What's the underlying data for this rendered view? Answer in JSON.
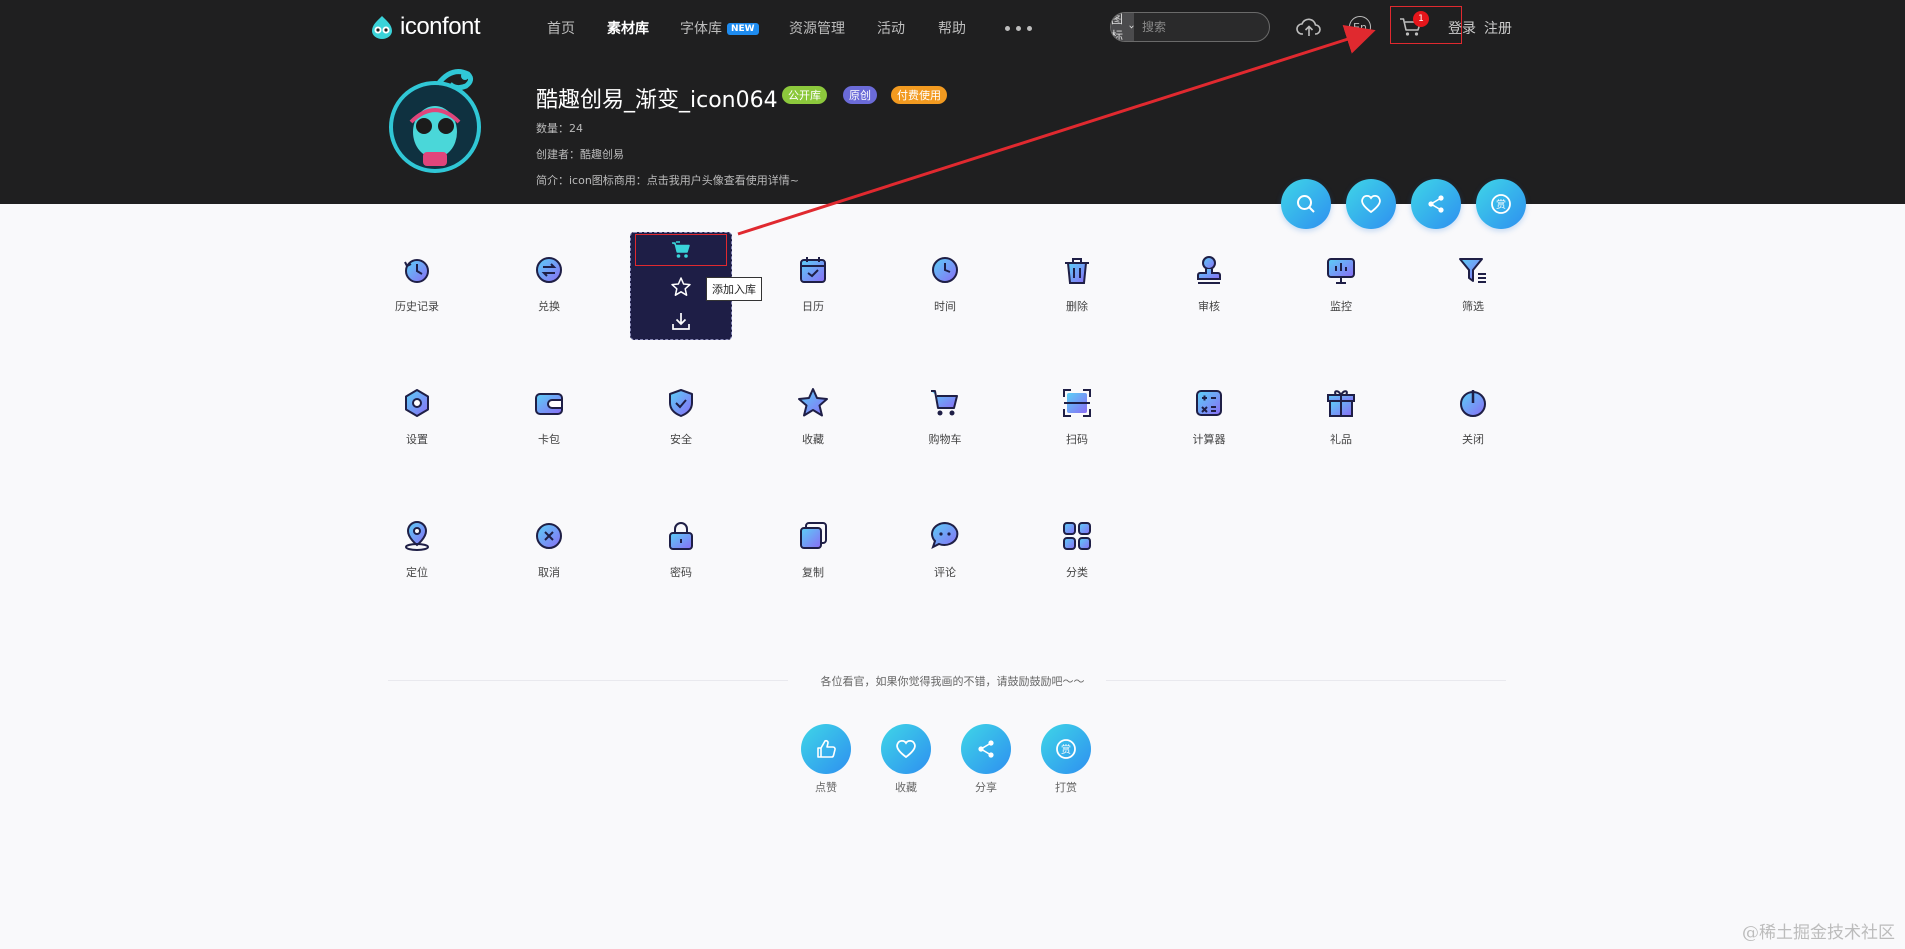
{
  "header": {
    "logo_text": "iconfont",
    "nav": [
      {
        "label": "首页",
        "active": false
      },
      {
        "label": "素材库",
        "active": true
      },
      {
        "label": "字体库",
        "badge": "NEW",
        "active": false
      },
      {
        "label": "资源管理",
        "active": false
      },
      {
        "label": "活动",
        "active": false
      },
      {
        "label": "帮助",
        "active": false
      }
    ],
    "search": {
      "type": "图标",
      "placeholder": "搜索"
    },
    "language": "En",
    "cart_count": "1",
    "login": "登录",
    "register": "注册"
  },
  "project": {
    "title": "酷趣创易_渐变_icon064",
    "tags": [
      {
        "label": "公开库",
        "color": "#8cc83c"
      },
      {
        "label": "原创",
        "color": "#6b6bd8"
      },
      {
        "label": "付费使用",
        "color": "#f29a20"
      }
    ],
    "count": "数量：24",
    "creator": "创建者：酷趣创易",
    "desc": "简介：icon图标商用：点击我用户头像查看使用详情~"
  },
  "icons": [
    {
      "label": "历史记录",
      "icon": "history-icon"
    },
    {
      "label": "兑换",
      "icon": "exchange-icon"
    },
    {
      "label": "",
      "icon": "hovered-icon"
    },
    {
      "label": "日历",
      "icon": "calendar-icon"
    },
    {
      "label": "时间",
      "icon": "clock-icon"
    },
    {
      "label": "删除",
      "icon": "trash-icon"
    },
    {
      "label": "审核",
      "icon": "stamp-icon"
    },
    {
      "label": "监控",
      "icon": "monitor-icon"
    },
    {
      "label": "筛选",
      "icon": "filter-icon"
    },
    {
      "label": "设置",
      "icon": "settings-icon"
    },
    {
      "label": "卡包",
      "icon": "wallet-icon"
    },
    {
      "label": "安全",
      "icon": "shield-icon"
    },
    {
      "label": "收藏",
      "icon": "star-icon"
    },
    {
      "label": "购物车",
      "icon": "cart-icon"
    },
    {
      "label": "扫码",
      "icon": "scan-icon"
    },
    {
      "label": "计算器",
      "icon": "calculator-icon"
    },
    {
      "label": "礼品",
      "icon": "gift-icon"
    },
    {
      "label": "关闭",
      "icon": "power-icon"
    },
    {
      "label": "定位",
      "icon": "location-icon"
    },
    {
      "label": "取消",
      "icon": "cancel-icon"
    },
    {
      "label": "密码",
      "icon": "lock-icon"
    },
    {
      "label": "复制",
      "icon": "copy-icon"
    },
    {
      "label": "评论",
      "icon": "comment-icon"
    },
    {
      "label": "分类",
      "icon": "category-icon"
    }
  ],
  "hover": {
    "tooltip": "添加入库"
  },
  "footer": {
    "encourage": "各位看官，如果你觉得我画的不错，请鼓励鼓励吧～～",
    "actions": [
      {
        "label": "点赞",
        "icon": "thumbs-up-icon"
      },
      {
        "label": "收藏",
        "icon": "heart-icon"
      },
      {
        "label": "分享",
        "icon": "share-icon"
      },
      {
        "label": "打赏",
        "icon": "reward-icon"
      }
    ]
  },
  "watermark": "@稀土掘金技术社区",
  "colors": {
    "accent": "#2e8ff0",
    "icon_fill": "#7b7cf6",
    "icon_stroke": "#1f1f46",
    "highlight": "#e0292f"
  }
}
